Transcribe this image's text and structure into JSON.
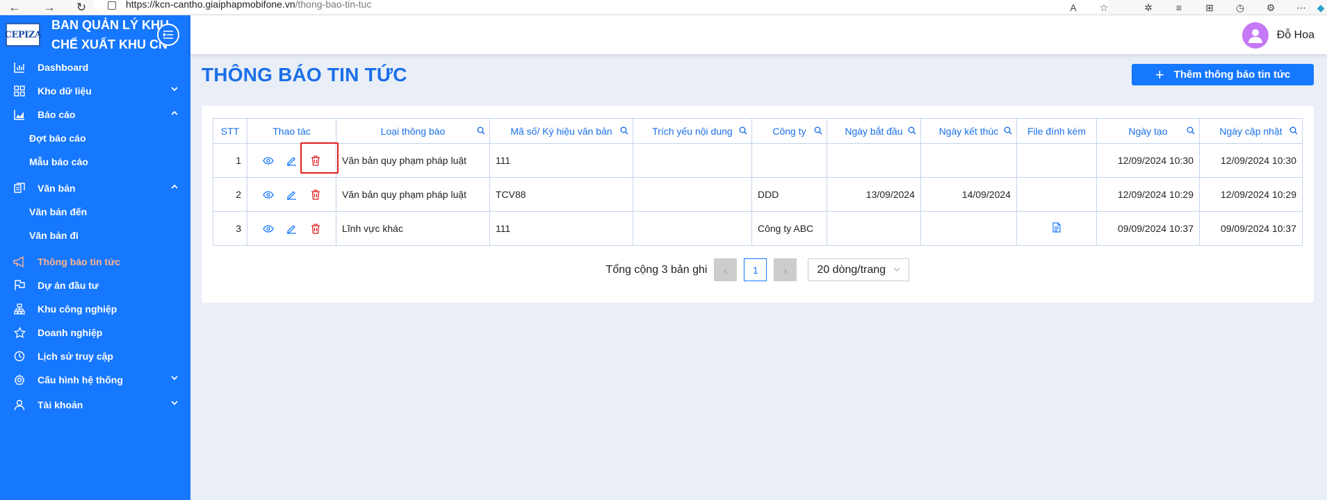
{
  "browser": {
    "url_host": "https://kcn-cantho.giaiphapmobifone.vn",
    "url_path": "/thong-bao-tin-tuc"
  },
  "sidebar": {
    "logo_text": "CEPIZA",
    "title": "BAN QUẢN LÝ KHU CHẾ XUẤT KHU CN",
    "items": [
      {
        "label": "Dashboard",
        "icon": "bar-chart-icon"
      },
      {
        "label": "Kho dữ liệu",
        "icon": "grid-icon"
      },
      {
        "label": "Báo cáo",
        "icon": "area-chart-icon"
      },
      {
        "label": "Đợt báo cáo"
      },
      {
        "label": "Mẫu báo cáo"
      },
      {
        "label": "Văn bản",
        "icon": "document-icon"
      },
      {
        "label": "Văn bản đến"
      },
      {
        "label": "Văn bản đi"
      },
      {
        "label": "Thông báo tin tức",
        "icon": "megaphone-icon"
      },
      {
        "label": "Dự án đầu tư",
        "icon": "flag-icon"
      },
      {
        "label": "Khu công nghiệp",
        "icon": "cluster-icon"
      },
      {
        "label": "Doanh nghiệp",
        "icon": "star-icon"
      },
      {
        "label": "Lịch sử truy cập",
        "icon": "clock-icon"
      },
      {
        "label": "Cấu hình hệ thống",
        "icon": "gear-icon"
      },
      {
        "label": "Tài khoản",
        "icon": "user-icon"
      }
    ],
    "active_color": "#ffb38a",
    "bg_color": "#1677ff"
  },
  "header": {
    "user_name": "Đỗ Hoa"
  },
  "page": {
    "title": "THÔNG BÁO TIN TỨC",
    "add_button": "Thêm thông báo tin tức"
  },
  "table": {
    "columns": [
      "STT",
      "Thao tác",
      "Loại thông báo",
      "Mã số/ Ký hiệu văn bản",
      "Trích yếu nội dung",
      "Công ty",
      "Ngày bắt đầu",
      "Ngày kết thúc",
      "File đính kèm",
      "Ngày tạo",
      "Ngày cập nhật"
    ],
    "rows": [
      {
        "stt": "1",
        "loai": "Văn bản quy phạm pháp luật",
        "maso": "111",
        "trichyeu": "",
        "congty": "",
        "batdau": "",
        "ketthuc": "",
        "file": false,
        "ngaytao": "12/09/2024 10:30",
        "capnhat": "12/09/2024 10:30"
      },
      {
        "stt": "2",
        "loai": "Văn bản quy phạm pháp luật",
        "maso": "TCV88",
        "trichyeu": "",
        "congty": "DDD",
        "batdau": "13/09/2024",
        "ketthuc": "14/09/2024",
        "file": false,
        "ngaytao": "12/09/2024 10:29",
        "capnhat": "12/09/2024 10:29"
      },
      {
        "stt": "3",
        "loai": "Lĩnh vực khác",
        "maso": "111",
        "trichyeu": "",
        "congty": "Công ty ABC",
        "batdau": "",
        "ketthuc": "",
        "file": true,
        "ngaytao": "09/09/2024 10:37",
        "capnhat": "09/09/2024 10:37"
      }
    ]
  },
  "pagination": {
    "total_text": "Tổng cộng 3 bản ghi",
    "current_page": "1",
    "page_size": "20 dòng/trang"
  },
  "colors": {
    "primary": "#1677ff",
    "delete": "#e01e1e"
  }
}
